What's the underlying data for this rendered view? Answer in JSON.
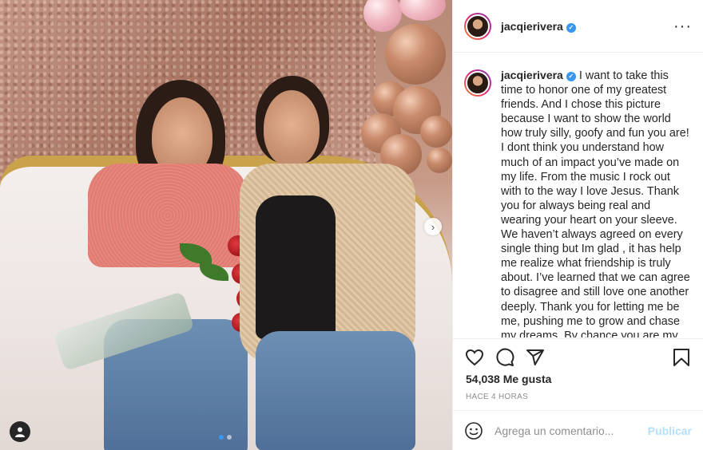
{
  "post": {
    "username": "jacqierivera",
    "caption": "I want to take this time to honor one of my greatest friends. And I chose this picture because I want to show the world how truly silly, goofy and fun you are! I dont think you understand how much of an impact you’ve made on my life. From the music I rock out with to the way I love Jesus. Thank you for always being real and wearing your heart on your sleeve. We haven’t always agreed on every single thing but Im glad , it has help me realize what friendship is truly about. I’ve learned that we can agree to disagree and still love one another deeply. Thank you for letting me be me, pushing me to grow and chase my dreams. By chance you are my tia, By choice you are my friend! . Im praying that this birthday marks the",
    "likes": "54,038 Me gusta",
    "time": "HACE 4 HORAS"
  },
  "comment": {
    "placeholder": "Agrega un comentario...",
    "post_label": "Publicar"
  },
  "carousel": {
    "total": 2,
    "active": 1
  },
  "colors": {
    "accent": "#3897f0",
    "post_disabled": "#b2dffc",
    "muted": "#8e8e8e"
  }
}
